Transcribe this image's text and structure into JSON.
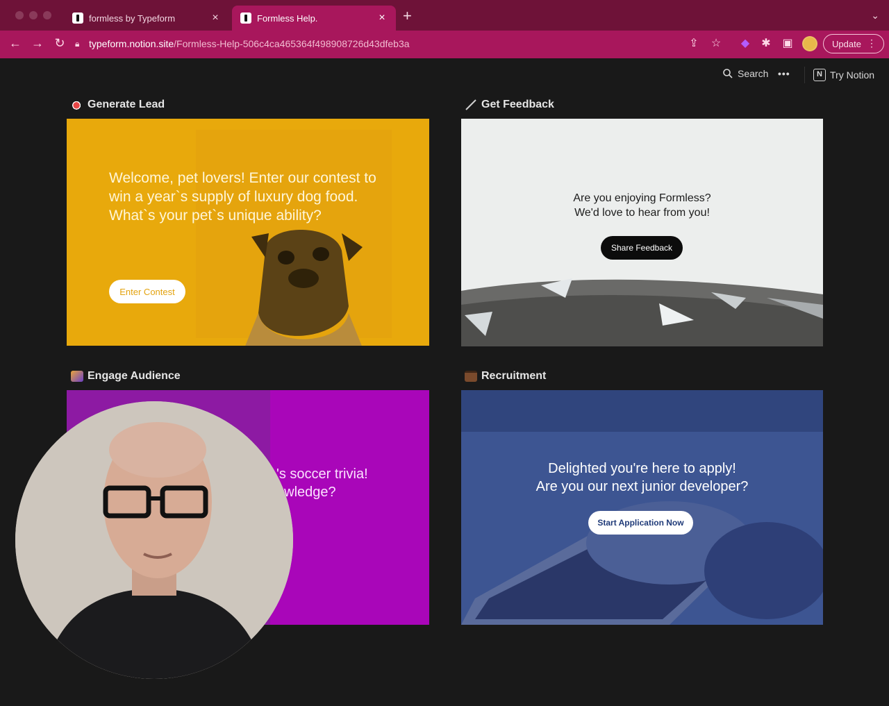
{
  "browser": {
    "tabs": [
      {
        "title": "formless by Typeform",
        "active": false
      },
      {
        "title": "Formless Help.",
        "active": true
      }
    ],
    "url_host": "typeform.notion.site",
    "url_path": "/Formless-Help-506c4ca465364f498908726d43dfeb3a",
    "update_label": "Update"
  },
  "notion_topbar": {
    "search_label": "Search",
    "more_label": "•••",
    "try_notion_label": "Try Notion"
  },
  "sections": {
    "lead": {
      "title": "Generate Lead",
      "headline": "Welcome, pet lovers! Enter our contest to win a year`s supply of luxury dog food. What`s your pet`s unique ability?",
      "button": "Enter Contest"
    },
    "feedback": {
      "title": "Get Feedback",
      "line1": "Are you enjoying Formless?",
      "line2": "We'd love to hear from you!",
      "button": "Share Feedback"
    },
    "engage": {
      "title": "Engage Audience",
      "line1": "'s soccer trivia!",
      "line2": "owledge?"
    },
    "recruit": {
      "title": "Recruitment",
      "line1": "Delighted you're here to apply!",
      "line2": "Are you our next junior developer?",
      "button": "Start Application Now"
    }
  },
  "colors": {
    "chrome_dark": "#6e1238",
    "chrome_accent": "#a8175c",
    "lead_bg": "#e8a90c",
    "engage_bg": "#a906b9",
    "recruit_bg": "#3a4f8c"
  }
}
